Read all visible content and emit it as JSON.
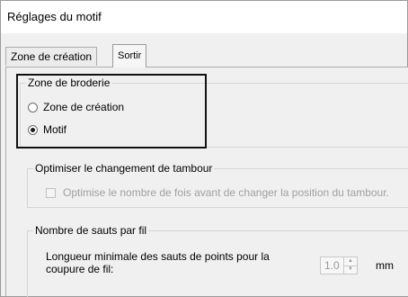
{
  "window": {
    "title": "Réglages du motif"
  },
  "tabs": [
    {
      "label": "Zone de création",
      "selected": false
    },
    {
      "label": "Sortir",
      "selected": true
    }
  ],
  "embroidery_zone": {
    "legend": "Zone de broderie",
    "options": [
      {
        "label": "Zone de création",
        "checked": false
      },
      {
        "label": "Motif",
        "checked": true
      }
    ]
  },
  "hoop_change": {
    "legend": "Optimiser le changement de tambour",
    "checkbox_label": "Optimise le nombre de fois avant de changer la position du tambour.",
    "checked": false,
    "enabled": false
  },
  "jumps": {
    "legend": "Nombre de sauts par fil",
    "label": "Longueur minimale des sauts de points pour la coupure de fil:",
    "value": "1.0",
    "unit": "mm",
    "spin_up_icon": "arrow-up-icon",
    "spin_down_icon": "arrow-down-icon"
  }
}
